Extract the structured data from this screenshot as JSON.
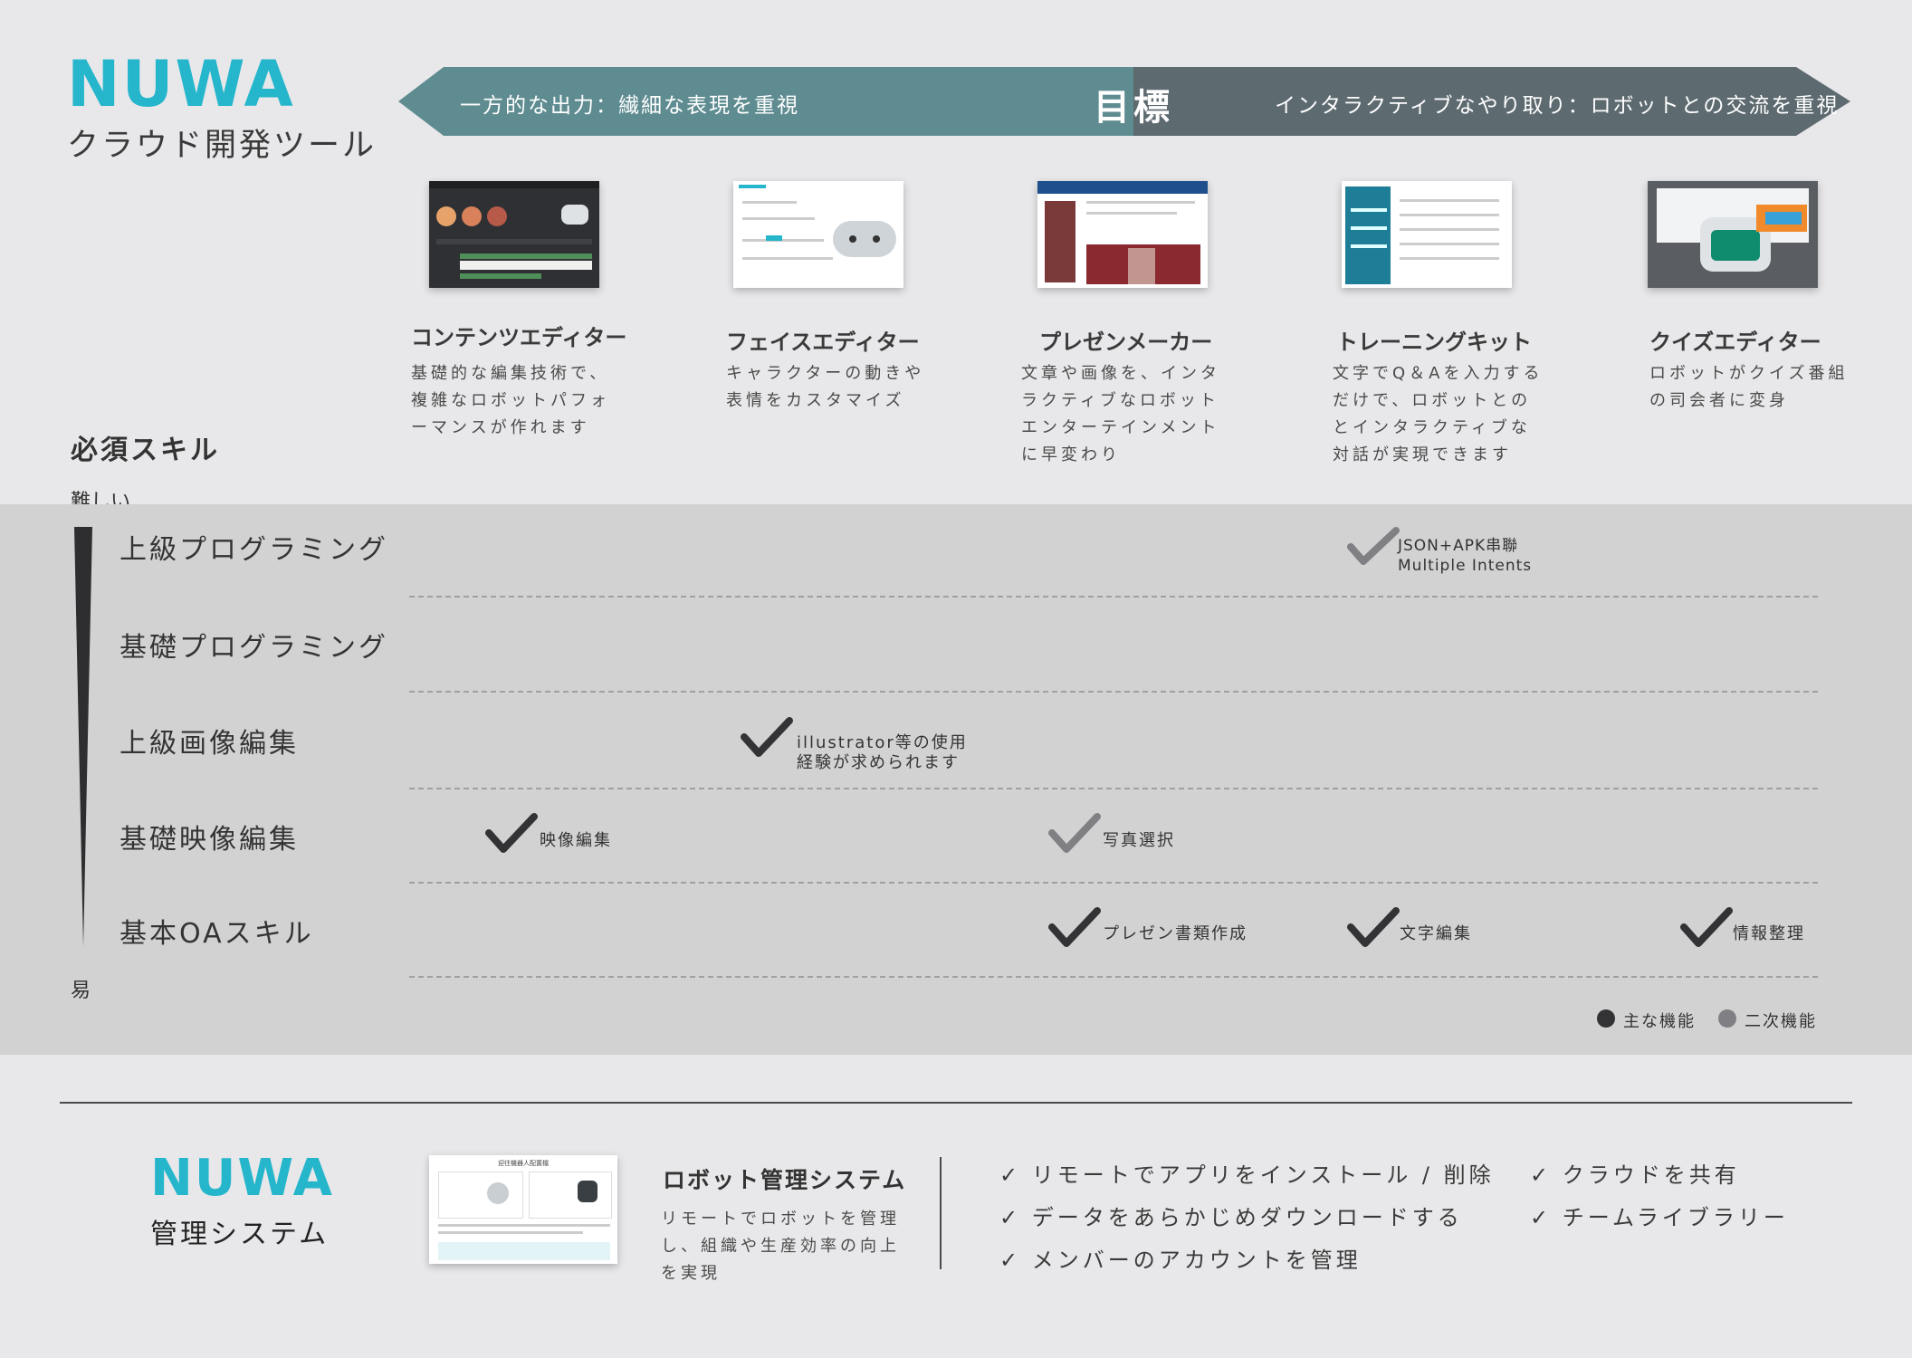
{
  "header": {
    "logo_text": "NUWA",
    "subtitle": "クラウド開発ツール",
    "colors": {
      "logo": "#25b6cc",
      "banner_left": "#5f8c91",
      "banner_right": "#5d6a70"
    }
  },
  "banner": {
    "left_text": "一方的な出力：繊細な表現を重視",
    "center_text": "目標",
    "right_text": "インタラクティブなやり取り：ロボットとの交流を重視"
  },
  "tools": [
    {
      "name": "コンテンツエディター",
      "desc": "基礎的な編集技術で、複雑なロボットパフォーマンスが作れます"
    },
    {
      "name": "フェイスエディター",
      "desc": "キャラクターの動きや表情をカスタマイズ"
    },
    {
      "name": "プレゼンメーカー",
      "desc": "文章や画像を、インタラクティブなロボットエンターテインメントに早変わり"
    },
    {
      "name": "トレーニングキット",
      "desc": "文字でQ＆Aを入力するだけで、ロボットとのとインタラクティブな対話が実現できます"
    },
    {
      "name": "クイズエディター",
      "desc": "ロボットがクイズ番組の司会者に変身"
    }
  ],
  "skills": {
    "section_title": "必須スキル",
    "hard_label": "難しい",
    "easy_label": "易",
    "rows": [
      {
        "label": "上級プログラミング"
      },
      {
        "label": "基礎プログラミング"
      },
      {
        "label": "上級画像編集"
      },
      {
        "label": "基礎映像編集"
      },
      {
        "label": "基本OAスキル"
      }
    ],
    "checks": [
      {
        "note_line1": "JSON+APK串聯",
        "note_line2": "Multiple Intents",
        "type": "secondary"
      },
      {
        "note_line1": "illustrator等の使用",
        "note_line2": "経験が求められます",
        "type": "main"
      },
      {
        "note": "映像編集",
        "type": "main"
      },
      {
        "note": "写真選択",
        "type": "secondary"
      },
      {
        "note": "プレゼン書類作成",
        "type": "main"
      },
      {
        "note": "文字編集",
        "type": "main"
      },
      {
        "note": "情報整理",
        "type": "main"
      }
    ],
    "legend": {
      "main": "主な機能",
      "secondary": "二次機能"
    }
  },
  "management": {
    "logo_text": "NUWA",
    "subtitle": "管理システム",
    "shot_title": "迎往機器人配置檔",
    "title": "ロボット管理システム",
    "desc": "リモートでロボットを管理し、組織や生産効率の向上を実現",
    "features_col1": [
      "✓ リモートでアプリをインストール / 削除",
      "✓ データをあらかじめダウンロードする",
      "✓ メンバーのアカウントを管理"
    ],
    "features_col2": [
      "✓ クラウドを共有",
      "✓ チームライブラリー"
    ]
  }
}
